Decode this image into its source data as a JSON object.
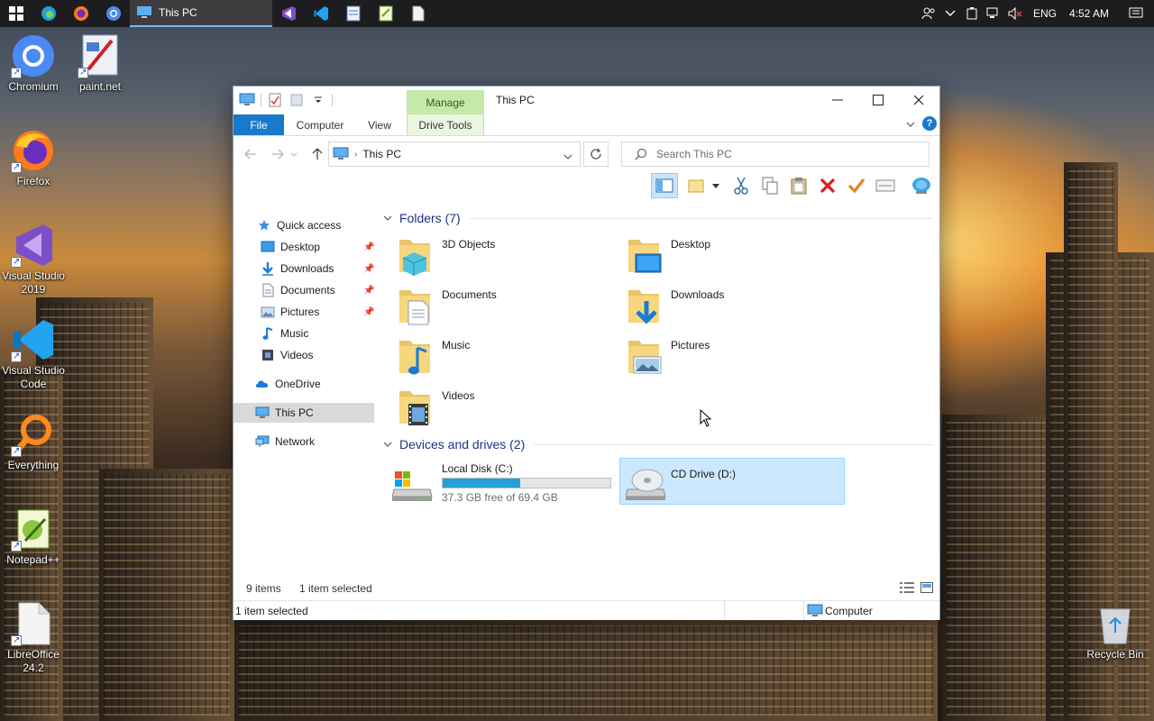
{
  "taskbar": {
    "active_window": "This PC",
    "tray": {
      "language": "ENG",
      "time": "4:52 AM"
    },
    "pinned": [
      "windows-start",
      "edge",
      "firefox",
      "chromium",
      "this-pc",
      "visual-studio",
      "vscode",
      "notepad",
      "notepadpp",
      "file"
    ]
  },
  "desktop_icons": [
    {
      "label": "Chromium",
      "icon": "chromium-icon"
    },
    {
      "label": "paint.net",
      "icon": "paintnet-icon"
    },
    {
      "label": "Firefox",
      "icon": "firefox-icon"
    },
    {
      "label": "Visual Studio 2019",
      "icon": "visual-studio-icon"
    },
    {
      "label": "Visual Studio Code",
      "icon": "vscode-icon"
    },
    {
      "label": "Everything",
      "icon": "everything-icon"
    },
    {
      "label": "Notepad++",
      "icon": "notepadpp-icon"
    },
    {
      "label": "LibreOffice 24.2",
      "icon": "libreoffice-icon"
    },
    {
      "label": "Recycle Bin",
      "icon": "recycle-bin-icon"
    }
  ],
  "window": {
    "title": "This PC",
    "contextual_tab": "Manage",
    "ribbon_tabs": [
      "File",
      "Computer",
      "View",
      "Drive Tools"
    ],
    "address": "This PC",
    "search_placeholder": "Search This PC",
    "nav": {
      "quick_access": "Quick access",
      "items": [
        "Desktop",
        "Downloads",
        "Documents",
        "Pictures",
        "Music",
        "Videos"
      ],
      "onedrive": "OneDrive",
      "this_pc": "This PC",
      "network": "Network"
    },
    "folders_header": "Folders (7)",
    "folders": [
      {
        "name": "3D Objects",
        "icon": "3d-objects-folder-icon"
      },
      {
        "name": "Desktop",
        "icon": "desktop-folder-icon"
      },
      {
        "name": "Documents",
        "icon": "documents-folder-icon"
      },
      {
        "name": "Downloads",
        "icon": "downloads-folder-icon"
      },
      {
        "name": "Music",
        "icon": "music-folder-icon"
      },
      {
        "name": "Pictures",
        "icon": "pictures-folder-icon"
      },
      {
        "name": "Videos",
        "icon": "videos-folder-icon"
      }
    ],
    "drives_header": "Devices and drives (2)",
    "drives": [
      {
        "name": "Local Disk (C:)",
        "free": "37.3 GB free of 69.4 GB",
        "used_fraction": 0.46
      },
      {
        "name": "CD Drive (D:)"
      }
    ],
    "status_items": "9 items",
    "status_selected": "1 item selected",
    "bottom_status_left": "1 item selected",
    "bottom_status_right": "Computer"
  },
  "colors": {
    "accent": "#1979ca",
    "manage_tab": "#c5e9a8",
    "selection": "#cce8ff",
    "drive_bar": "#26a0da",
    "taskbar": "#1d1d1f"
  }
}
